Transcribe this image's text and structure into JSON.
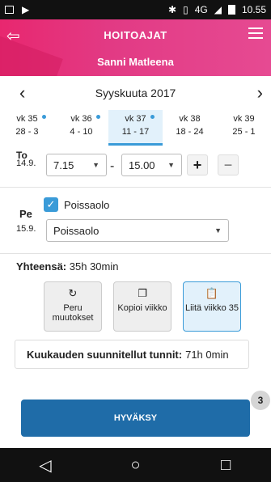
{
  "status_bar": {
    "time": "10.55",
    "network": "4G"
  },
  "header": {
    "title": "HOITOAJAT",
    "subtitle": "Sanni Matleena"
  },
  "month": {
    "label": "Syyskuuta 2017"
  },
  "weeks": [
    {
      "label": "vk 35",
      "range": "28 - 3",
      "has_dot": true,
      "active": false
    },
    {
      "label": "vk 36",
      "range": "4 - 10",
      "has_dot": true,
      "active": false
    },
    {
      "label": "vk 37",
      "range": "11 - 17",
      "has_dot": true,
      "active": true
    },
    {
      "label": "vk 38",
      "range": "18 - 24",
      "has_dot": false,
      "active": false
    },
    {
      "label": "vk 39",
      "range": "25 - 1",
      "has_dot": false,
      "active": false
    }
  ],
  "thursday": {
    "day": "To",
    "date": "14.9.",
    "start": "7.15",
    "end": "15.00",
    "separator": "-",
    "plus": "+",
    "minus": "−"
  },
  "friday": {
    "day": "Pe",
    "date": "15.9.",
    "checkbox_label": "Poissaolo",
    "checked": true,
    "select_value": "Poissaolo"
  },
  "total": {
    "label": "Yhteensä:",
    "value": "35h 30min"
  },
  "actions": [
    {
      "label": "Peru muutokset",
      "icon": "undo-icon",
      "glyph": "↻"
    },
    {
      "label": "Kopioi viikko",
      "icon": "copy-icon",
      "glyph": "❐"
    },
    {
      "label": "Liitä viikko 35",
      "icon": "paste-icon",
      "glyph": "📋"
    }
  ],
  "summary": {
    "label": "Kuukauden suunnitellut tunnit:",
    "value": "71h 0min"
  },
  "approve": {
    "label": "HYVÄKSY",
    "badge": "3"
  },
  "colors": {
    "header": "#e8276f",
    "accent": "#3a9bd8",
    "approve": "#1f6ca8"
  }
}
